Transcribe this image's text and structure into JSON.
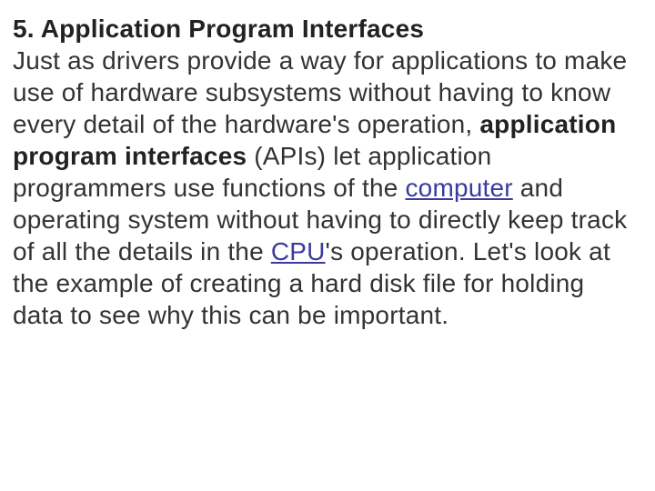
{
  "heading": "5. Application Program Interfaces",
  "body": {
    "t1": "Just as drivers provide a way for applications to make use of hardware subsystems without having to know every detail of the hardware's operation, ",
    "bold1": "application program interfaces",
    "t2": " (APIs) let application programmers use functions of the ",
    "link1": "computer",
    "t3": " and operating system without having to directly keep track of all the details in the ",
    "link2": "CPU",
    "t4": "'s operation. Let's look at the example of creating a hard disk file for holding data to see why this can be important."
  }
}
